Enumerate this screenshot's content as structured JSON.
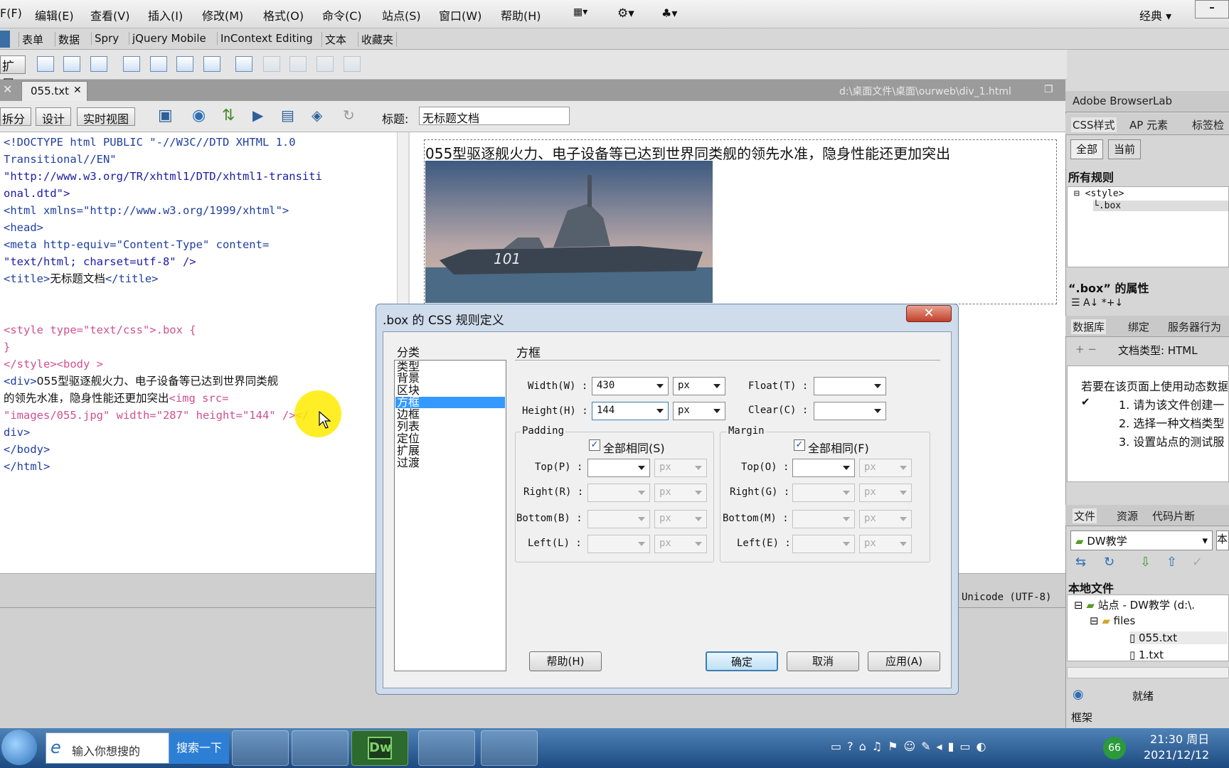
{
  "menubar": {
    "items": [
      "F(F)",
      "编辑(E)",
      "查看(V)",
      "插入(I)",
      "修改(M)",
      "格式(O)",
      "命令(C)",
      "站点(S)",
      "窗口(W)",
      "帮助(H)"
    ],
    "workspace": "经典"
  },
  "insert_tabs": [
    "表单",
    "数据",
    "Spry",
    "jQuery Mobile",
    "InContext Editing",
    "文本",
    "收藏夹"
  ],
  "toolbar": {
    "expand_label": "扩展"
  },
  "document": {
    "tab_name": "055.txt",
    "path": "d:\\桌面文件\\桌面\\ourweb\\div_1.html"
  },
  "viewbar": {
    "split": "拆分",
    "design": "设计",
    "live": "实时视图",
    "title_label": "标题:",
    "title_value": "无标题文档"
  },
  "code_lines": {
    "l1": "<!DOCTYPE html PUBLIC \"-//W3C//DTD XHTML 1.0",
    "l2": "Transitional//EN\"",
    "l3": "\"http://www.w3.org/TR/xhtml1/DTD/xhtml1-transiti",
    "l4": "onal.dtd\">",
    "l5": "<html xmlns=\"http://www.w3.org/1999/xhtml\">",
    "l6": "<head>",
    "l7": "<meta http-equiv=\"Content-Type\" content=",
    "l8": "\"text/html; charset=utf-8\" />",
    "l9a": "<title>",
    "l9b": "无标题文档",
    "l9c": "</title>",
    "l10a": "<style type=\"text/css\">",
    "l10b": ".box {",
    "l11": "}",
    "l12": "</style><body >",
    "l13a": "<div>",
    "l13b": "055型驱逐舰火力、电子设备等已达到世界同类舰",
    "l14a": "的领先水准，隐身性能还更加突出",
    "l14b": "<img src=",
    "l15": "\"images/055.jpg\" width=\"287\" height=\"144\" /></",
    "l16": "div>",
    "l17": "</body>",
    "l18": "</html>"
  },
  "design_view": {
    "text": "055型驱逐舰火力、电子设备等已达到世界同类舰的领先水准，隐身性能还更加突出",
    "image_hull_number": "101"
  },
  "statusbar": {
    "encoding": "Unicode (UTF-8)"
  },
  "right_panel": {
    "browserlab": "Adobe BrowserLab",
    "css_tabs": [
      "CSS样式",
      "AP 元素",
      "标签检"
    ],
    "css_mode": [
      "全部",
      "当前"
    ],
    "all_rules_label": "所有规则",
    "rules": [
      "<style>",
      ".box"
    ],
    "props_title": "“.box” 的属性",
    "db_tabs": [
      "数据库",
      "绑定",
      "服务器行为"
    ],
    "doctype_label": "文档类型: HTML",
    "db_msg": "若要在该页面上使用动态数据",
    "db_steps": [
      "1. 请为该文件创建一",
      "2. 选择一种文档类型",
      "3. 设置站点的测试服"
    ],
    "file_tabs": [
      "文件",
      "资源",
      "代码片断"
    ],
    "site_select": "DW教学",
    "site_view": "本",
    "local_files_label": "本地文件",
    "tree": [
      "站点 - DW教学 (d:\\.",
      "files",
      "055.txt",
      "1.txt"
    ],
    "ready": "就绪",
    "frames": "框架"
  },
  "dialog": {
    "title": ".box 的 CSS 规则定义",
    "close": "✕",
    "category_label": "分类",
    "categories": [
      "类型",
      "背景",
      "区块",
      "方框",
      "边框",
      "列表",
      "定位",
      "扩展",
      "过渡"
    ],
    "selected_category": "方框",
    "section_title": "方框",
    "width_label": "Width(W) :",
    "width_value": "430",
    "width_unit": "px",
    "height_label": "Height(H) :",
    "height_value": "144",
    "height_unit": "px",
    "float_label": "Float(T) :",
    "clear_label": "Clear(C) :",
    "padding_label": "Padding",
    "margin_label": "Margin",
    "padding_same": "全部相同(S)",
    "margin_same": "全部相同(F)",
    "padding_fields": [
      "Top(P) :",
      "Right(R) :",
      "Bottom(B) :",
      "Left(L) :"
    ],
    "margin_fields": [
      "Top(O) :",
      "Right(G) :",
      "Bottom(M) :",
      "Left(E) :"
    ],
    "unit_placeholder": "px",
    "buttons": {
      "help": "帮助(H)",
      "ok": "确定",
      "cancel": "取消",
      "apply": "应用(A)"
    }
  },
  "taskbar": {
    "search_placeholder": "输入你想搜的",
    "search_button": "搜索一下",
    "time": "21:30 周日",
    "date": "2021/12/12",
    "badge": "66"
  },
  "colors": {
    "selection": "#3399ff",
    "dialog_frame": "#cfdcec",
    "taskbar": "#2a5a92",
    "highlight": "#ffeb00"
  }
}
